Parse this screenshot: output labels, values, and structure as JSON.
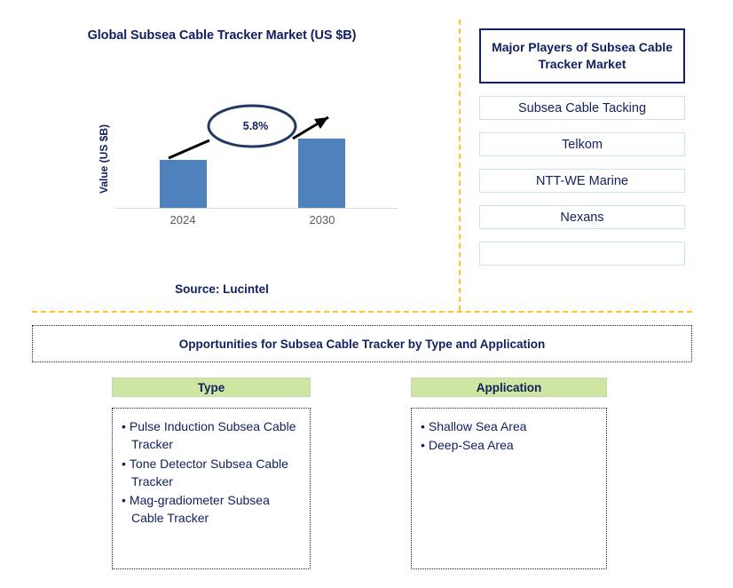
{
  "chart_panel": {
    "title": "Global Subsea Cable Tracker Market (US $B)",
    "source": "Source: Lucintel"
  },
  "chart_data": {
    "type": "bar",
    "title": "Global Subsea Cable Tracker Market (US $B)",
    "categories": [
      "2024",
      "2030"
    ],
    "values": [
      54,
      78
    ],
    "xlabel": "",
    "ylabel": "Value (US $B)",
    "annotation": "5.8%",
    "annotation_type": "cagr-ellipse",
    "grid": false,
    "legend": false,
    "bar_color": "#4f81bd",
    "tick_label_color": "#595959"
  },
  "players_panel": {
    "header": "Major Players of Subsea Cable Tracker Market",
    "items": [
      {
        "label": "Subsea Cable Tacking"
      },
      {
        "label": "Telkom"
      },
      {
        "label": "NTT-WE Marine"
      },
      {
        "label": "Nexans"
      },
      {
        "label": ""
      }
    ]
  },
  "opportunities": {
    "banner": "Opportunities for Subsea Cable Tracker by Type and Application",
    "columns": [
      {
        "header": "Type",
        "items": [
          "Pulse Induction Subsea Cable Tracker",
          "Tone Detector Subsea Cable Tracker",
          "Mag-gradiometer Subsea Cable Tracker"
        ]
      },
      {
        "header": "Application",
        "items": [
          "Shallow Sea Area",
          "Deep-Sea Area"
        ]
      }
    ],
    "bullet_glyph": "•"
  },
  "colors": {
    "navy": "#11205e",
    "bar_blue": "#4f81bd",
    "divider_gold": "#ffc425",
    "header_green": "#cfe5a2",
    "box_border_light": "#cfe0f0"
  }
}
